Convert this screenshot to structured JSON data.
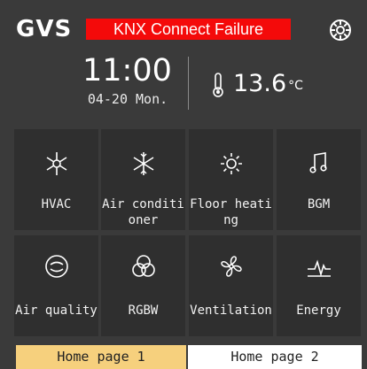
{
  "header": {
    "logo": "GVS",
    "alert": "KNX Connect Failure",
    "settings_icon": "gear-icon"
  },
  "clock": {
    "time": "11:00",
    "date": "04-20  Mon."
  },
  "weather": {
    "temperature": "13.6",
    "unit": "°C",
    "icon": "thermometer-icon"
  },
  "tiles": [
    {
      "label": "HVAC",
      "icon": "snowflake-sun-icon"
    },
    {
      "label": "Air conditi oner",
      "icon": "snowflake-icon"
    },
    {
      "label": "Floor heati ng",
      "icon": "sun-icon"
    },
    {
      "label": "BGM",
      "icon": "music-note-icon"
    },
    {
      "label": "Air quality",
      "icon": "air-quality-icon"
    },
    {
      "label": "RGBW",
      "icon": "rgb-circles-icon"
    },
    {
      "label": "Ventilation",
      "icon": "fan-icon"
    },
    {
      "label": "Energy",
      "icon": "energy-pulse-icon"
    }
  ],
  "tiles_display": {
    "t0": "HVAC",
    "t1a": "Air conditi",
    "t1b": "oner",
    "t2a": "Floor heati",
    "t2b": "ng",
    "t3": "BGM",
    "t4": "Air quality",
    "t5": "RGBW",
    "t6": "Ventilation",
    "t7": "Energy"
  },
  "tabs": [
    {
      "label": "Home page 1",
      "active": true
    },
    {
      "label": "Home page 2",
      "active": false
    }
  ],
  "colors": {
    "background": "#3a3a3a",
    "tile": "#2f2f2f",
    "alert": "#f40a0a",
    "active_tab": "#f6d07d",
    "inactive_tab": "#ffffff"
  }
}
